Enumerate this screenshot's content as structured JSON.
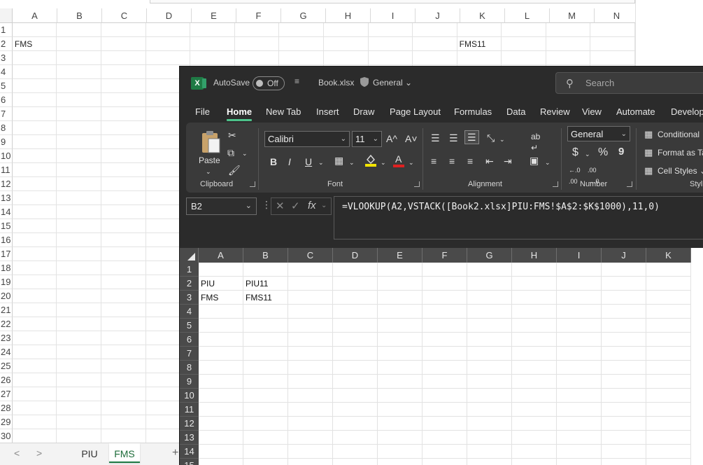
{
  "background_sheet": {
    "columns": [
      "A",
      "B",
      "C",
      "D",
      "E",
      "F",
      "G",
      "H",
      "I",
      "J",
      "K",
      "L",
      "M",
      "N"
    ],
    "rows": [
      "1",
      "2",
      "3",
      "4",
      "5",
      "6",
      "7",
      "8",
      "9",
      "10",
      "11",
      "12",
      "13",
      "14",
      "15",
      "16",
      "17",
      "18",
      "19",
      "20",
      "21",
      "22",
      "23",
      "24",
      "25",
      "26",
      "27",
      "28",
      "29",
      "30"
    ],
    "cells": {
      "A2": "FMS",
      "K2": "FMS11"
    },
    "sheet_tabs": [
      "PIU",
      "FMS"
    ],
    "active_tab": "FMS",
    "nav_prev": "<",
    "nav_next": ">",
    "add_sheet": "+"
  },
  "window": {
    "autosave_label": "AutoSave",
    "autosave_state": "Off",
    "file_name": "Book.xlsx",
    "sensitivity": "General",
    "search_placeholder": "Search",
    "app_badge": "X"
  },
  "ribbon_tabs": [
    "File",
    "Home",
    "New Tab",
    "Insert",
    "Draw",
    "Page Layout",
    "Formulas",
    "Data",
    "Review",
    "View",
    "Automate",
    "Develop"
  ],
  "active_ribbon_tab": "Home",
  "ribbon": {
    "clipboard": {
      "paste_label": "Paste",
      "group_label": "Clipboard"
    },
    "font": {
      "name": "Calibri",
      "size": "11",
      "bold": "B",
      "italic": "I",
      "underline": "U",
      "grow": "A^",
      "shrink": "A˅",
      "font_color": "A",
      "group_label": "Font"
    },
    "alignment": {
      "group_label": "Alignment"
    },
    "number": {
      "format": "General",
      "currency": "$",
      "percent": "%",
      "comma": "9",
      "group_label": "Number"
    },
    "styles": {
      "conditional": "Conditional",
      "format_table": "Format as Ta",
      "cell_styles": "Cell Styles",
      "group_label": "Styl"
    }
  },
  "formula_bar": {
    "name_box": "B2",
    "fx": "fx",
    "formula": "=VLOOKUP(A2,VSTACK([Book2.xlsx]PIU:FMS!$A$2:$K$1000),11,0)"
  },
  "foreground_sheet": {
    "columns": [
      "A",
      "B",
      "C",
      "D",
      "E",
      "F",
      "G",
      "H",
      "I",
      "J",
      "K"
    ],
    "rows": [
      "1",
      "2",
      "3",
      "4",
      "5",
      "6",
      "7",
      "8",
      "9",
      "10",
      "11",
      "12",
      "13",
      "14",
      "15"
    ],
    "cells": {
      "A2": "PIU",
      "B2": "PIU11",
      "A3": "FMS",
      "B3": "FMS11"
    }
  }
}
